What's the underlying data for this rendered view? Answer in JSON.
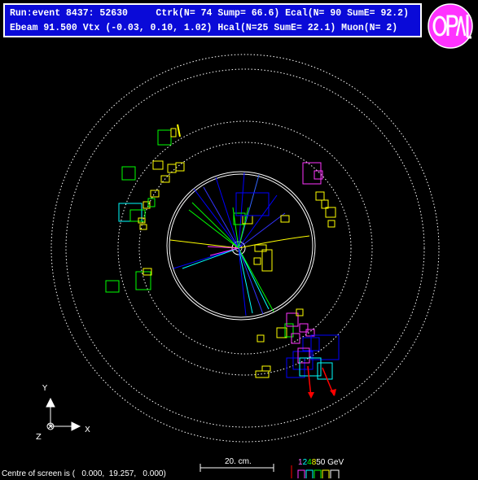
{
  "header": {
    "line1": "Run:event 8437: 52630     Ctrk(N= 74 Sump= 66.6) Ecal(N= 90 SumE= 92.2)",
    "line2": "Ebeam 91.500 Vtx (-0.03, 0.10, 1.02) Hcal(N=25 SumE= 22.1) Muon(N= 2)"
  },
  "axes": {
    "y": "Y",
    "x": "X",
    "z": "Z"
  },
  "scale": {
    "label": "20. cm."
  },
  "energy_key": {
    "values": [
      "1",
      "2",
      "4",
      "8",
      "50 GeV"
    ],
    "colors": [
      "#ff66ff",
      "#00ffff",
      "#00ff00",
      "#ffff00",
      "#ffffff"
    ]
  },
  "footer": {
    "centre": "Centre of screen is (   0.000,  19.257,   0.000)"
  },
  "colors": {
    "header_bg": "#0a0ad8",
    "logo_fill": "#ff33ff"
  }
}
